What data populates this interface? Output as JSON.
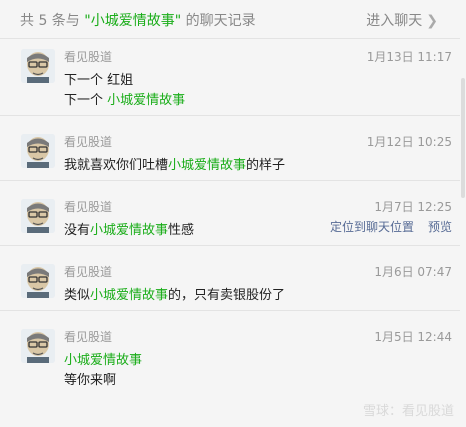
{
  "header": {
    "summary_prefix": "共 5 条与 ",
    "summary_keyword": "\"小城爱情故事\"",
    "summary_suffix": " 的聊天记录",
    "enter_chat": "进入聊天",
    "chevron": "❯"
  },
  "keyword": "小城爱情故事",
  "messages": [
    {
      "sender": "看见股道",
      "time": "1月13日 11:17",
      "lines": [
        {
          "pre": "下一个  红姐",
          "kw": "",
          "post": ""
        },
        {
          "pre": "下一个  ",
          "kw": "小城爱情故事",
          "post": ""
        }
      ]
    },
    {
      "sender": "看见股道",
      "time": "1月12日 10:25",
      "lines": [
        {
          "pre": "我就喜欢你们吐槽",
          "kw": "小城爱情故事",
          "post": "的样子"
        }
      ]
    },
    {
      "sender": "看见股道",
      "time": "1月7日 12:25",
      "lines": [
        {
          "pre": "没有",
          "kw": "小城爱情故事",
          "post": "性感"
        }
      ],
      "actions": {
        "locate": "定位到聊天位置",
        "preview": "预览"
      }
    },
    {
      "sender": "看见股道",
      "time": "1月6日 07:47",
      "lines": [
        {
          "pre": "类似",
          "kw": "小城爱情故事",
          "post": "的，只有卖银股份了"
        }
      ]
    },
    {
      "sender": "看见股道",
      "time": "1月5日 12:44",
      "lines": [
        {
          "pre": "",
          "kw": "小城爱情故事",
          "post": ""
        },
        {
          "pre": "等你来啊",
          "kw": "",
          "post": ""
        }
      ]
    }
  ],
  "watermark": "雪球：看见股道",
  "colors": {
    "keyword": "#1aad19",
    "link": "#576b95",
    "meta": "#9a9a9a",
    "background": "#f5f5f5"
  }
}
